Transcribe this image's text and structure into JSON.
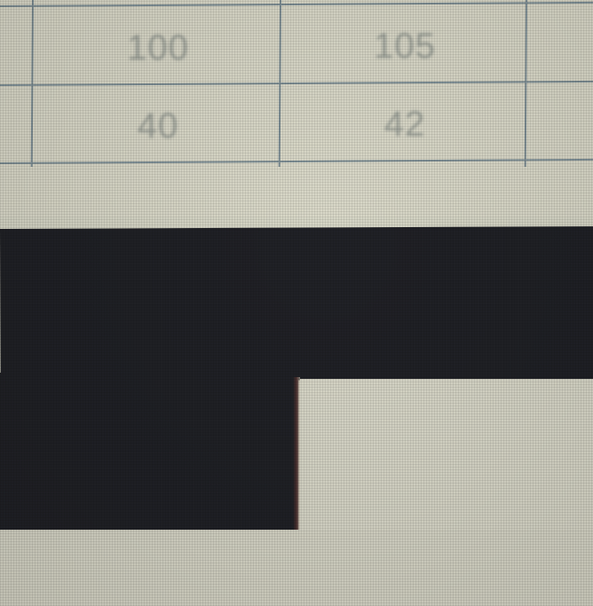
{
  "spreadsheet": {
    "rows": [
      {
        "cells": [
          "100",
          "105"
        ]
      },
      {
        "cells": [
          "40",
          "42"
        ]
      }
    ]
  },
  "colors": {
    "background": "#d6d6c6",
    "gridline": "#7e8f96",
    "cell_text": "#9a9f97",
    "dark_block": "#202126"
  }
}
